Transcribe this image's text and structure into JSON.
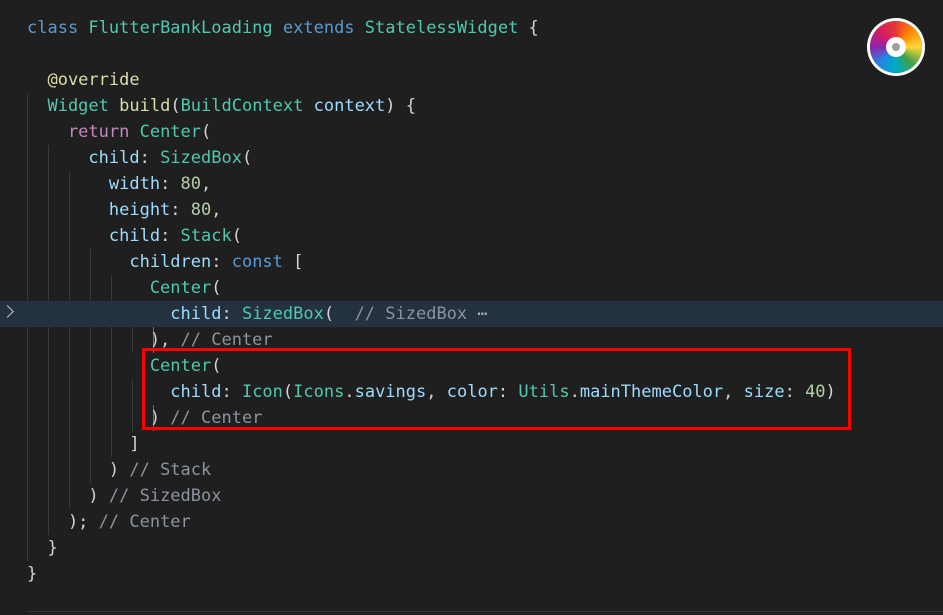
{
  "lines": [
    {
      "tokens": [
        {
          "t": "class ",
          "c": "kw"
        },
        {
          "t": "FlutterBankLoading ",
          "c": "type"
        },
        {
          "t": "extends ",
          "c": "kw"
        },
        {
          "t": "StatelessWidget ",
          "c": "type"
        },
        {
          "t": "{",
          "c": "punc"
        }
      ]
    },
    {
      "tokens": []
    },
    {
      "tokens": [
        {
          "t": "  @override",
          "c": "ann"
        }
      ]
    },
    {
      "tokens": [
        {
          "t": "  Widget ",
          "c": "type"
        },
        {
          "t": "build",
          "c": "fn"
        },
        {
          "t": "(",
          "c": "punc"
        },
        {
          "t": "BuildContext ",
          "c": "type"
        },
        {
          "t": "context",
          "c": "prop"
        },
        {
          "t": ") {",
          "c": "punc"
        }
      ]
    },
    {
      "tokens": [
        {
          "t": "    return ",
          "c": "ctrl"
        },
        {
          "t": "Center",
          "c": "type"
        },
        {
          "t": "(",
          "c": "punc"
        }
      ]
    },
    {
      "tokens": [
        {
          "t": "      child",
          "c": "prop"
        },
        {
          "t": ": ",
          "c": "punc"
        },
        {
          "t": "SizedBox",
          "c": "type"
        },
        {
          "t": "(",
          "c": "punc"
        }
      ]
    },
    {
      "tokens": [
        {
          "t": "        width",
          "c": "prop"
        },
        {
          "t": ": ",
          "c": "punc"
        },
        {
          "t": "80",
          "c": "num"
        },
        {
          "t": ",",
          "c": "punc"
        }
      ]
    },
    {
      "tokens": [
        {
          "t": "        height",
          "c": "prop"
        },
        {
          "t": ": ",
          "c": "punc"
        },
        {
          "t": "80",
          "c": "num"
        },
        {
          "t": ",",
          "c": "punc"
        }
      ]
    },
    {
      "tokens": [
        {
          "t": "        child",
          "c": "prop"
        },
        {
          "t": ": ",
          "c": "punc"
        },
        {
          "t": "Stack",
          "c": "type"
        },
        {
          "t": "(",
          "c": "punc"
        }
      ]
    },
    {
      "tokens": [
        {
          "t": "          children",
          "c": "prop"
        },
        {
          "t": ": ",
          "c": "punc"
        },
        {
          "t": "const ",
          "c": "kw"
        },
        {
          "t": "[",
          "c": "punc"
        }
      ]
    },
    {
      "tokens": [
        {
          "t": "            Center",
          "c": "type"
        },
        {
          "t": "(",
          "c": "punc"
        }
      ]
    },
    {
      "folded": true,
      "tokens": [
        {
          "t": "              child",
          "c": "prop"
        },
        {
          "t": ": ",
          "c": "punc"
        },
        {
          "t": "SizedBox",
          "c": "type"
        },
        {
          "t": "(  ",
          "c": "punc"
        },
        {
          "t": "// SizedBox ",
          "c": "cmt"
        },
        {
          "t": "⋯",
          "c": "ellipsis"
        }
      ]
    },
    {
      "tokens": [
        {
          "t": "            ), ",
          "c": "punc"
        },
        {
          "t": "// Center",
          "c": "cmt"
        }
      ]
    },
    {
      "tokens": [
        {
          "t": "            Center",
          "c": "type"
        },
        {
          "t": "(",
          "c": "punc"
        }
      ]
    },
    {
      "tokens": [
        {
          "t": "              child",
          "c": "prop"
        },
        {
          "t": ": ",
          "c": "punc"
        },
        {
          "t": "Icon",
          "c": "type"
        },
        {
          "t": "(",
          "c": "punc"
        },
        {
          "t": "Icons",
          "c": "type"
        },
        {
          "t": ".",
          "c": "punc"
        },
        {
          "t": "savings",
          "c": "prop"
        },
        {
          "t": ", ",
          "c": "punc"
        },
        {
          "t": "color",
          "c": "prop"
        },
        {
          "t": ": ",
          "c": "punc"
        },
        {
          "t": "Utils",
          "c": "type"
        },
        {
          "t": ".",
          "c": "punc"
        },
        {
          "t": "mainThemeColor",
          "c": "prop"
        },
        {
          "t": ", ",
          "c": "punc"
        },
        {
          "t": "size",
          "c": "prop"
        },
        {
          "t": ": ",
          "c": "punc"
        },
        {
          "t": "40",
          "c": "num"
        },
        {
          "t": ")",
          "c": "punc"
        }
      ]
    },
    {
      "tokens": [
        {
          "t": "            ) ",
          "c": "punc"
        },
        {
          "t": "// Center",
          "c": "cmt"
        }
      ]
    },
    {
      "tokens": [
        {
          "t": "          ]",
          "c": "punc"
        }
      ]
    },
    {
      "tokens": [
        {
          "t": "        ) ",
          "c": "punc"
        },
        {
          "t": "// Stack",
          "c": "cmt"
        }
      ]
    },
    {
      "tokens": [
        {
          "t": "      ) ",
          "c": "punc"
        },
        {
          "t": "// SizedBox",
          "c": "cmt"
        }
      ]
    },
    {
      "tokens": [
        {
          "t": "    ); ",
          "c": "punc"
        },
        {
          "t": "// Center",
          "c": "cmt"
        }
      ]
    },
    {
      "tokens": [
        {
          "t": "  }",
          "c": "punc"
        }
      ]
    },
    {
      "tokens": [
        {
          "t": "}",
          "c": "punc"
        }
      ]
    }
  ],
  "colors": {
    "background": "#1f1f1f",
    "highlight_border": "#ff0000",
    "folded_line_bg": "#24313f"
  },
  "icons": {
    "fold": "chevron-right-icon",
    "color_picker": "color-wheel-icon"
  }
}
